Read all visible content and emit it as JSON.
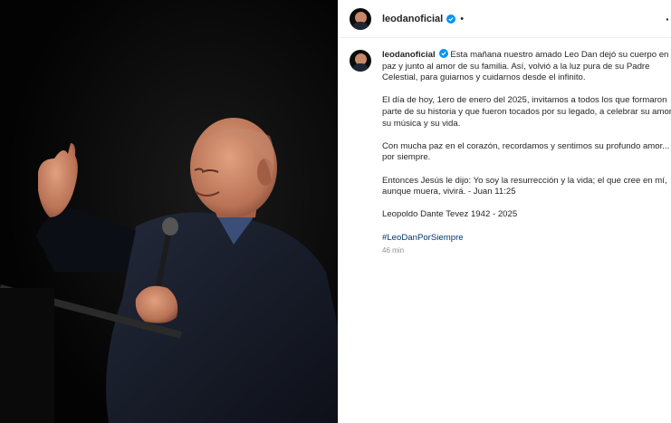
{
  "post": {
    "author": {
      "username": "leodanoficial",
      "verified_icon": "verified-badge-icon",
      "verified_color": "#0095f6"
    },
    "header": {
      "separator": "•",
      "more_label": "···"
    },
    "caption": {
      "username": "leodanoficial",
      "paragraphs": [
        "Esta mañana nuestro amado Leo Dan dejó su cuerpo en paz y junto al amor de su familia. Así, volvió a la luz pura de su Padre Celestial, para guiarnos y cuidarnos desde el infinito.",
        "El día de hoy, 1ero de enero del 2025, invitamos a todos los que formaron parte de su historia y que fueron tocados por su legado, a celebrar su amor, su música y su vida.",
        "Con mucha paz en el corazón, recordamos y sentimos su profundo amor... por siempre.",
        "Entonces Jesús le dijo: Yo soy la resurrección y la vida; el que cree en mí, aunque muera, vivirá. - Juan 11:25",
        "Leopoldo Dante Tevez 1942 - 2025"
      ],
      "hashtag": "#LeoDanPorSiempre",
      "time": "46 min"
    },
    "photo": {
      "description_icon": "photo"
    }
  },
  "colors": {
    "background": "#ffffff",
    "photo_background": "#050505",
    "text": "#262626",
    "muted": "#8e8e8e",
    "link": "#00376b",
    "border": "#efefef"
  }
}
